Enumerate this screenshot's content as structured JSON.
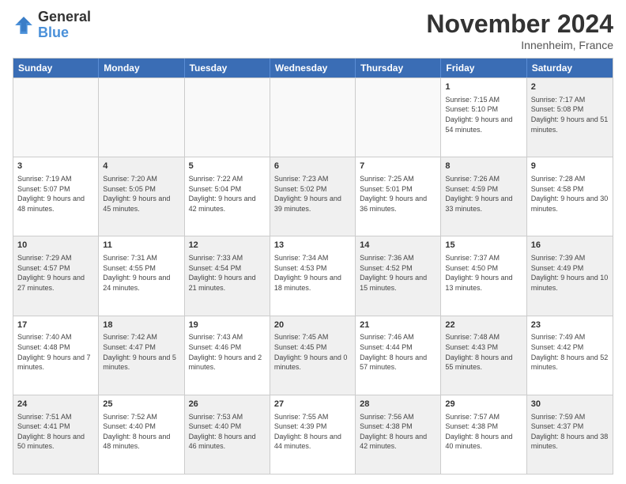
{
  "logo": {
    "text_general": "General",
    "text_blue": "Blue"
  },
  "header": {
    "month": "November 2024",
    "location": "Innenheim, France"
  },
  "weekdays": [
    "Sunday",
    "Monday",
    "Tuesday",
    "Wednesday",
    "Thursday",
    "Friday",
    "Saturday"
  ],
  "rows": [
    [
      {
        "day": "",
        "info": "",
        "shaded": true
      },
      {
        "day": "",
        "info": "",
        "shaded": true
      },
      {
        "day": "",
        "info": "",
        "shaded": true
      },
      {
        "day": "",
        "info": "",
        "shaded": true
      },
      {
        "day": "",
        "info": "",
        "shaded": true
      },
      {
        "day": "1",
        "info": "Sunrise: 7:15 AM\nSunset: 5:10 PM\nDaylight: 9 hours and 54 minutes.",
        "shaded": false
      },
      {
        "day": "2",
        "info": "Sunrise: 7:17 AM\nSunset: 5:08 PM\nDaylight: 9 hours and 51 minutes.",
        "shaded": true
      }
    ],
    [
      {
        "day": "3",
        "info": "Sunrise: 7:19 AM\nSunset: 5:07 PM\nDaylight: 9 hours and 48 minutes.",
        "shaded": false
      },
      {
        "day": "4",
        "info": "Sunrise: 7:20 AM\nSunset: 5:05 PM\nDaylight: 9 hours and 45 minutes.",
        "shaded": true
      },
      {
        "day": "5",
        "info": "Sunrise: 7:22 AM\nSunset: 5:04 PM\nDaylight: 9 hours and 42 minutes.",
        "shaded": false
      },
      {
        "day": "6",
        "info": "Sunrise: 7:23 AM\nSunset: 5:02 PM\nDaylight: 9 hours and 39 minutes.",
        "shaded": true
      },
      {
        "day": "7",
        "info": "Sunrise: 7:25 AM\nSunset: 5:01 PM\nDaylight: 9 hours and 36 minutes.",
        "shaded": false
      },
      {
        "day": "8",
        "info": "Sunrise: 7:26 AM\nSunset: 4:59 PM\nDaylight: 9 hours and 33 minutes.",
        "shaded": true
      },
      {
        "day": "9",
        "info": "Sunrise: 7:28 AM\nSunset: 4:58 PM\nDaylight: 9 hours and 30 minutes.",
        "shaded": false
      }
    ],
    [
      {
        "day": "10",
        "info": "Sunrise: 7:29 AM\nSunset: 4:57 PM\nDaylight: 9 hours and 27 minutes.",
        "shaded": true
      },
      {
        "day": "11",
        "info": "Sunrise: 7:31 AM\nSunset: 4:55 PM\nDaylight: 9 hours and 24 minutes.",
        "shaded": false
      },
      {
        "day": "12",
        "info": "Sunrise: 7:33 AM\nSunset: 4:54 PM\nDaylight: 9 hours and 21 minutes.",
        "shaded": true
      },
      {
        "day": "13",
        "info": "Sunrise: 7:34 AM\nSunset: 4:53 PM\nDaylight: 9 hours and 18 minutes.",
        "shaded": false
      },
      {
        "day": "14",
        "info": "Sunrise: 7:36 AM\nSunset: 4:52 PM\nDaylight: 9 hours and 15 minutes.",
        "shaded": true
      },
      {
        "day": "15",
        "info": "Sunrise: 7:37 AM\nSunset: 4:50 PM\nDaylight: 9 hours and 13 minutes.",
        "shaded": false
      },
      {
        "day": "16",
        "info": "Sunrise: 7:39 AM\nSunset: 4:49 PM\nDaylight: 9 hours and 10 minutes.",
        "shaded": true
      }
    ],
    [
      {
        "day": "17",
        "info": "Sunrise: 7:40 AM\nSunset: 4:48 PM\nDaylight: 9 hours and 7 minutes.",
        "shaded": false
      },
      {
        "day": "18",
        "info": "Sunrise: 7:42 AM\nSunset: 4:47 PM\nDaylight: 9 hours and 5 minutes.",
        "shaded": true
      },
      {
        "day": "19",
        "info": "Sunrise: 7:43 AM\nSunset: 4:46 PM\nDaylight: 9 hours and 2 minutes.",
        "shaded": false
      },
      {
        "day": "20",
        "info": "Sunrise: 7:45 AM\nSunset: 4:45 PM\nDaylight: 9 hours and 0 minutes.",
        "shaded": true
      },
      {
        "day": "21",
        "info": "Sunrise: 7:46 AM\nSunset: 4:44 PM\nDaylight: 8 hours and 57 minutes.",
        "shaded": false
      },
      {
        "day": "22",
        "info": "Sunrise: 7:48 AM\nSunset: 4:43 PM\nDaylight: 8 hours and 55 minutes.",
        "shaded": true
      },
      {
        "day": "23",
        "info": "Sunrise: 7:49 AM\nSunset: 4:42 PM\nDaylight: 8 hours and 52 minutes.",
        "shaded": false
      }
    ],
    [
      {
        "day": "24",
        "info": "Sunrise: 7:51 AM\nSunset: 4:41 PM\nDaylight: 8 hours and 50 minutes.",
        "shaded": true
      },
      {
        "day": "25",
        "info": "Sunrise: 7:52 AM\nSunset: 4:40 PM\nDaylight: 8 hours and 48 minutes.",
        "shaded": false
      },
      {
        "day": "26",
        "info": "Sunrise: 7:53 AM\nSunset: 4:40 PM\nDaylight: 8 hours and 46 minutes.",
        "shaded": true
      },
      {
        "day": "27",
        "info": "Sunrise: 7:55 AM\nSunset: 4:39 PM\nDaylight: 8 hours and 44 minutes.",
        "shaded": false
      },
      {
        "day": "28",
        "info": "Sunrise: 7:56 AM\nSunset: 4:38 PM\nDaylight: 8 hours and 42 minutes.",
        "shaded": true
      },
      {
        "day": "29",
        "info": "Sunrise: 7:57 AM\nSunset: 4:38 PM\nDaylight: 8 hours and 40 minutes.",
        "shaded": false
      },
      {
        "day": "30",
        "info": "Sunrise: 7:59 AM\nSunset: 4:37 PM\nDaylight: 8 hours and 38 minutes.",
        "shaded": true
      }
    ]
  ]
}
